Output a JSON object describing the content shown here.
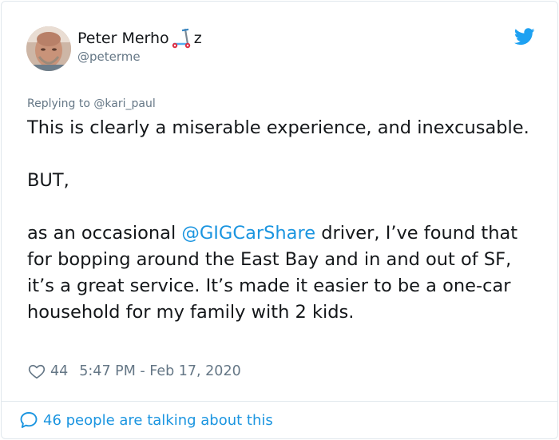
{
  "author": {
    "name_start": "Peter Merho",
    "name_end": "z",
    "name_emoji": "kick-scooter-emoji",
    "handle": "@peterme",
    "avatar": "avatar-photo"
  },
  "platform_icon": "twitter-bird-icon",
  "reply": {
    "prefix": "Replying to ",
    "to": "@kari_paul"
  },
  "tweet": {
    "line1": "This is clearly a miserable experience, and inexcusable.",
    "line2": "BUT,",
    "line3_start": "as an occasional ",
    "mention": "@GIGCarShare",
    "line3_end": " driver, I’ve found that for bopping around the East Bay and in and out of SF, it’s a great service. It’s made it easier to be a one-car household for my family with 2 kids."
  },
  "stats": {
    "likes_icon": "heart-icon",
    "likes": "44",
    "timestamp": "5:47 PM - Feb 17, 2020"
  },
  "footer": {
    "icon": "speech-bubble-icon",
    "label": "46 people are talking about this"
  },
  "colors": {
    "link": "#1b95e0",
    "secondary_text": "#657786",
    "border": "#e1e8ed",
    "twitter_blue": "#1da1f2"
  }
}
